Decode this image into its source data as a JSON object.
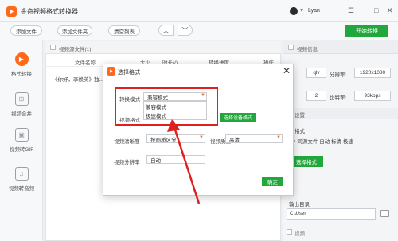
{
  "app": {
    "title": "金舟视频格式转换器"
  },
  "user": {
    "name": "Lyan",
    "vip_icon": "heart-icon"
  },
  "window_controls": {
    "menu": "☰",
    "minimize": "－",
    "maximize": "□",
    "close": "✕"
  },
  "toolbar": {
    "add_file": "添加文件",
    "add_folder": "添加文件夹",
    "clear_list": "清空列表",
    "up_arrow": "︿",
    "down_arrow": "﹀",
    "start": "开始转换"
  },
  "sidebar": {
    "items": [
      {
        "label": "格式转换",
        "icon": "play-circle-icon",
        "active": true
      },
      {
        "label": "视频合并",
        "icon": "merge-icon",
        "active": false
      },
      {
        "label": "视频转GIF",
        "icon": "gif-icon",
        "active": false
      },
      {
        "label": "视频转音频",
        "icon": "music-note-icon",
        "active": false
      }
    ]
  },
  "file_list": {
    "header": "视频源文件(1)",
    "columns": [
      "文件名称",
      "大小",
      "时长(/)",
      "转换进度",
      "操作"
    ],
    "rows": [
      {
        "name": "《你好，李焕英》独..."
      }
    ]
  },
  "info_panel": {
    "header": "视频信息",
    "format_value": "qlv",
    "resolution_label": "分辨率:",
    "resolution_value": "1920x1080",
    "frame_value": "2",
    "bitrate_label": "比特率:",
    "bitrate_value": "93kbps",
    "settings_header": "设置",
    "format_section": "格式",
    "format_desc": "4 同源文件 自动 标清 极速",
    "choose_format_btn": "选择格式",
    "output_label": "输出目录",
    "output_path": "C:\\User",
    "bottom_text": "视频..."
  },
  "modal": {
    "title": "选择格式",
    "convert_mode_label": "转换模式",
    "convert_mode_value": "兼容模式",
    "options": [
      "兼容模式",
      "极速模式"
    ],
    "video_format_label": "视频格式",
    "choose_device_btn": "选择设备格式",
    "clarity_label": "视频清晰度",
    "clarity_value": "按画质区分",
    "quality_label": "视频质量",
    "quality_value": "高清",
    "resolution_label": "视频分辨率",
    "resolution_value": "自动",
    "ok_btn": "确定"
  },
  "colors": {
    "brand_orange": "#ff6a1a",
    "green": "#22a73c",
    "highlight_red": "#e02020"
  }
}
